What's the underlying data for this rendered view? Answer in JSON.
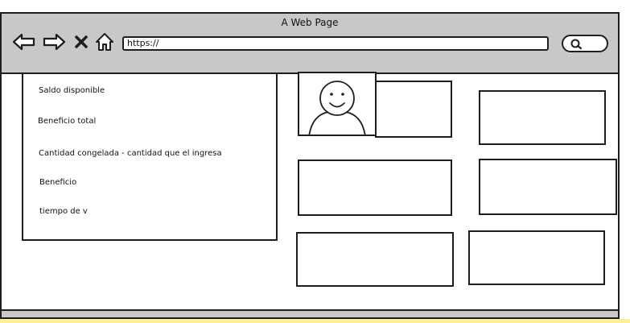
{
  "browser": {
    "title": "A Web Page",
    "url": "https://",
    "nav_icons": [
      "back-arrow-icon",
      "forward-arrow-icon",
      "close-x-icon",
      "home-icon"
    ],
    "search_icon": "search-icon"
  },
  "panel": {
    "items": [
      {
        "label": "Saldo disponible"
      },
      {
        "label": "Beneficio total"
      },
      {
        "label": "Cantidad congelada - cantidad que el ingresa"
      },
      {
        "label": "Beneficio"
      },
      {
        "label": "tiempo de v"
      }
    ]
  },
  "profile": {
    "avatar_icon": "user-avatar-icon"
  }
}
